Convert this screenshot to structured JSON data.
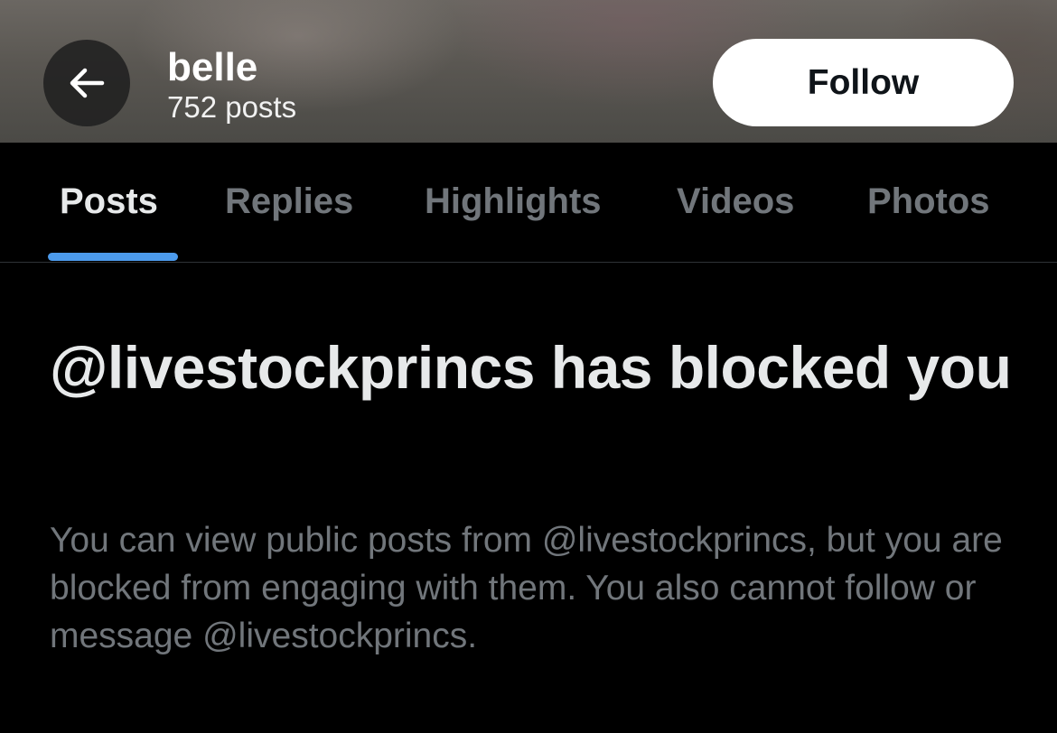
{
  "header": {
    "back_icon": "arrow-left-icon",
    "name": "belle",
    "post_count": "752 posts",
    "follow_label": "Follow"
  },
  "tabs": [
    {
      "label": "Posts",
      "active": true
    },
    {
      "label": "Replies",
      "active": false
    },
    {
      "label": "Highlights",
      "active": false
    },
    {
      "label": "Videos",
      "active": false
    },
    {
      "label": "Photos",
      "active": false
    }
  ],
  "blocked": {
    "title": "@livestockprincs has blocked you",
    "body": "You can view public posts from @livestockprincs, but you are blocked from engaging with them. You also cannot follow or message @livestockprincs."
  },
  "colors": {
    "accent": "#4c9aeb",
    "primary_text": "#e7e9ea",
    "secondary_text": "#71767b",
    "background": "#000000"
  }
}
